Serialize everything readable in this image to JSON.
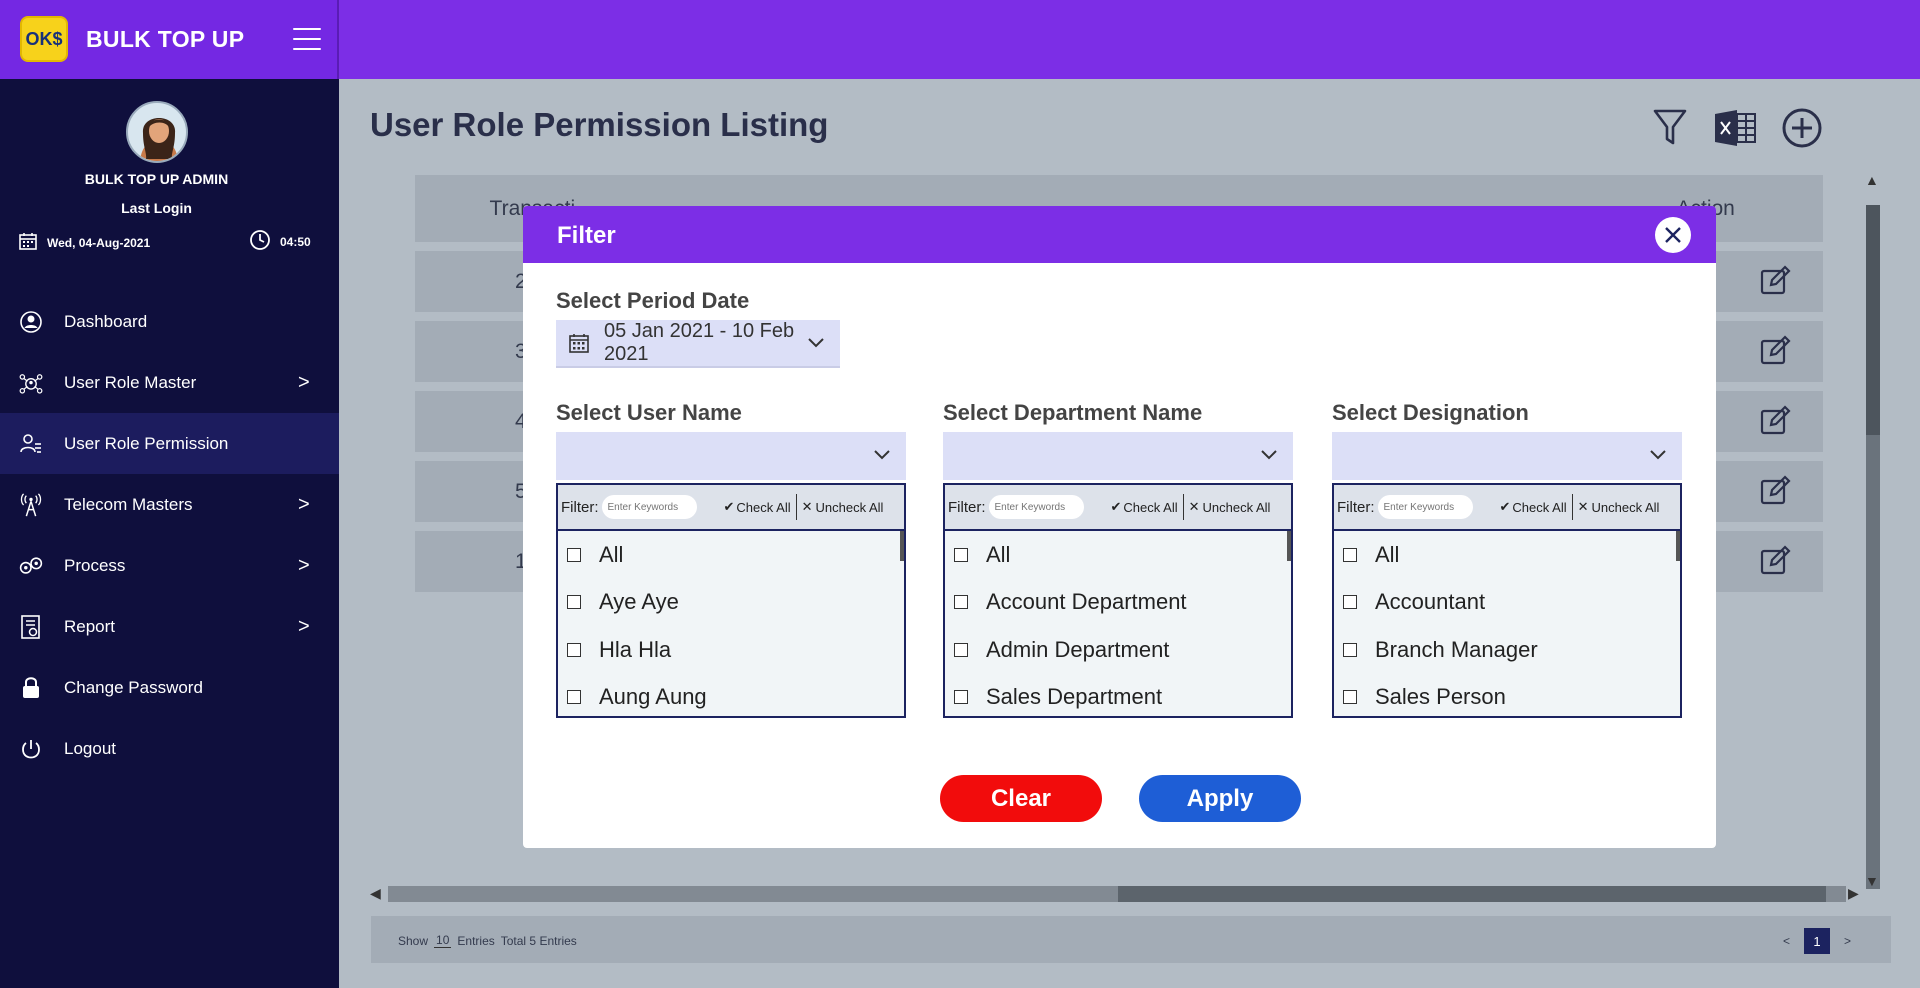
{
  "app": {
    "brand_name": "BULK TOP UP",
    "logo_text": "OK$"
  },
  "user": {
    "name": "BULK TOP UP ADMIN",
    "last_login_label": "Last Login",
    "date": "Wed, 04-Aug-2021",
    "time": "04:50"
  },
  "sidebar": {
    "items": [
      {
        "label": "Dashboard",
        "icon": "dashboard-icon",
        "has_submenu": false
      },
      {
        "label": "User Role Master",
        "icon": "user-role-master-icon",
        "has_submenu": true
      },
      {
        "label": "User Role Permission",
        "icon": "user-role-permission-icon",
        "has_submenu": false,
        "active": true
      },
      {
        "label": "Telecom Masters",
        "icon": "tower-icon",
        "has_submenu": true
      },
      {
        "label": "Process",
        "icon": "process-icon",
        "has_submenu": true
      },
      {
        "label": "Report",
        "icon": "report-icon",
        "has_submenu": true
      },
      {
        "label": "Change Password",
        "icon": "lock-icon",
        "has_submenu": false
      },
      {
        "label": "Logout",
        "icon": "power-icon",
        "has_submenu": false
      }
    ],
    "chevron": ">"
  },
  "main": {
    "title": "User Role Permission Listing",
    "table": {
      "headers": [
        "Transacti",
        "",
        "",
        "",
        "",
        "Action"
      ],
      "rows": [
        {
          "first": "2"
        },
        {
          "first": "3"
        },
        {
          "first": "4"
        },
        {
          "first": "5"
        },
        {
          "first": "1"
        }
      ]
    },
    "footer": {
      "show_label": "Show",
      "show_value": "10",
      "entries_label": "Entries",
      "total_label": "Total 5 Entries",
      "current_page": "1",
      "prev": "<",
      "next": ">"
    }
  },
  "filter_modal": {
    "title": "Filter",
    "period_label": "Select Period Date",
    "period_value": "05 Jan 2021 - 10 Feb 2021",
    "filter_label": "Filter:",
    "keyword_placeholder": "Enter Keywords",
    "check_all": "Check All",
    "uncheck_all": "Uncheck All",
    "selects": [
      {
        "label": "Select User Name",
        "options": [
          "All",
          "Aye Aye",
          "Hla Hla",
          "Aung Aung"
        ]
      },
      {
        "label": "Select Department Name",
        "options": [
          "All",
          "Account Department",
          "Admin Department",
          "Sales Department"
        ]
      },
      {
        "label": "Select Designation",
        "options": [
          "All",
          "Accountant",
          "Branch Manager",
          "Sales Person"
        ]
      }
    ],
    "clear_label": "Clear",
    "apply_label": "Apply"
  },
  "colors": {
    "header": "#7c2ee6",
    "sidebar": "#0f0f3d",
    "clear": "#f20c0c",
    "apply": "#1e5ed6"
  }
}
